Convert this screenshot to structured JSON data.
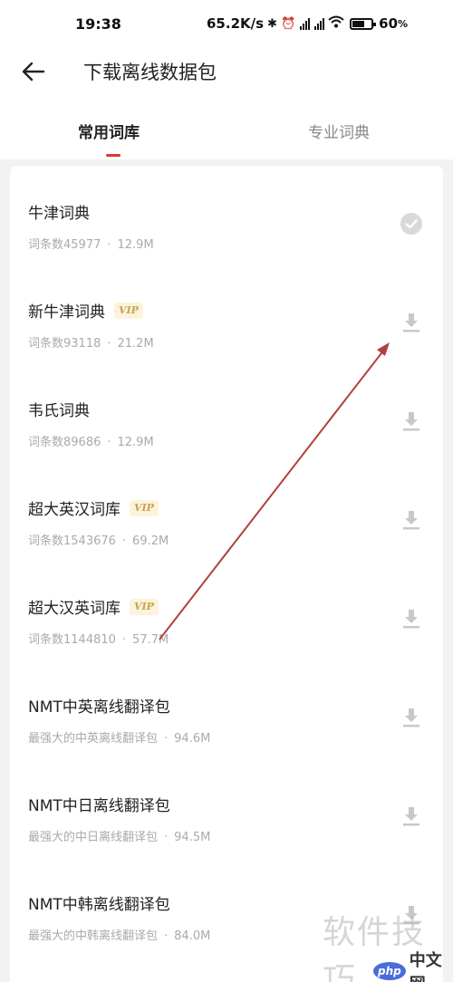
{
  "status_bar": {
    "time": "19:38",
    "network_speed": "65.2K/s",
    "battery_percent": "60",
    "battery_unit": "%",
    "icons": [
      "bluetooth-icon",
      "alarm-icon",
      "signal-hd-icon",
      "signal-hd-icon",
      "wifi-icon",
      "battery-icon"
    ]
  },
  "header": {
    "title": "下载离线数据包",
    "back_icon": "back-arrow-icon"
  },
  "tabs": [
    {
      "label": "常用词库",
      "active": true
    },
    {
      "label": "专业词典",
      "active": false
    }
  ],
  "items": [
    {
      "name": "牛津词典",
      "vip": "",
      "meta_count": "词条数45977",
      "meta_size": "12.9M",
      "status": "downloaded"
    },
    {
      "name": "新牛津词典",
      "vip": "VIP",
      "meta_count": "词条数93118",
      "meta_size": "21.2M",
      "status": "download"
    },
    {
      "name": "韦氏词典",
      "vip": "",
      "meta_count": "词条数89686",
      "meta_size": "12.9M",
      "status": "download"
    },
    {
      "name": "超大英汉词库",
      "vip": "VIP",
      "meta_count": "词条数1543676",
      "meta_size": "69.2M",
      "status": "download"
    },
    {
      "name": "超大汉英词库",
      "vip": "VIP",
      "meta_count": "词条数1144810",
      "meta_size": "57.7M",
      "status": "download"
    },
    {
      "name": "NMT中英离线翻译包",
      "vip": "",
      "meta_count": "最强大的中英离线翻译包",
      "meta_size": "94.6M",
      "status": "download"
    },
    {
      "name": "NMT中日离线翻译包",
      "vip": "",
      "meta_count": "最强大的中日离线翻译包",
      "meta_size": "94.5M",
      "status": "download"
    },
    {
      "name": "NMT中韩离线翻译包",
      "vip": "",
      "meta_count": "最强大的中韩离线翻译包",
      "meta_size": "84.0M",
      "status": "download"
    }
  ],
  "meta_separator": "·",
  "watermark": {
    "text": "软件技巧",
    "php_badge": "php",
    "site": "中文网"
  },
  "colors": {
    "accent": "#e0352b",
    "annotation_arrow": "#b0413e",
    "vip_text": "#c9a34a",
    "icon_gray": "#c8c8c8"
  }
}
